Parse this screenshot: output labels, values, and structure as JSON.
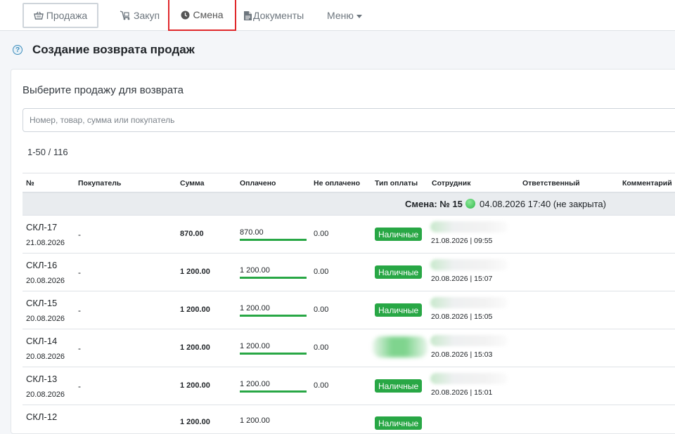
{
  "nav": {
    "sale": "Продажа",
    "purchase": "Закуп",
    "shift": "Смена",
    "documents": "Документы",
    "menu": "Меню"
  },
  "page": {
    "title": "Создание возврата продаж",
    "subtitle": "Выберите продажу для возврата"
  },
  "search": {
    "placeholder": "Номер, товар, сумма или покупатель",
    "value": ""
  },
  "pager": "1-50 / 116",
  "table": {
    "headers": {
      "num": "№",
      "buyer": "Покупатель",
      "sum": "Сумма",
      "paid": "Оплачено",
      "unpaid": "Не оплачено",
      "pay_type": "Тип оплаты",
      "employee": "Сотрудник",
      "responsible": "Ответственный",
      "comment": "Комментарий"
    },
    "shift": {
      "label": "Смена: № 15",
      "info": "04.08.2026 17:40 (не закрыта)"
    },
    "rows": [
      {
        "num": "СКЛ-17",
        "date": "21.08.2026",
        "buyer": "-",
        "sum": "870.00",
        "paid": "870.00",
        "unpaid": "0.00",
        "pay_type": "Наличные",
        "emp_date": "21.08.2026 | 09:55"
      },
      {
        "num": "СКЛ-16",
        "date": "20.08.2026",
        "buyer": "-",
        "sum": "1 200.00",
        "paid": "1 200.00",
        "unpaid": "0.00",
        "pay_type": "Наличные",
        "emp_date": "20.08.2026 | 15:07"
      },
      {
        "num": "СКЛ-15",
        "date": "20.08.2026",
        "buyer": "-",
        "sum": "1 200.00",
        "paid": "1 200.00",
        "unpaid": "0.00",
        "pay_type": "Наличные",
        "emp_date": "20.08.2026 | 15:05"
      },
      {
        "num": "СКЛ-14",
        "date": "20.08.2026",
        "buyer": "-",
        "sum": "1 200.00",
        "paid": "1 200.00",
        "unpaid": "0.00",
        "pay_type": "",
        "emp_date": "20.08.2026 | 15:03"
      },
      {
        "num": "СКЛ-13",
        "date": "20.08.2026",
        "buyer": "-",
        "sum": "1 200.00",
        "paid": "1 200.00",
        "unpaid": "0.00",
        "pay_type": "Наличные",
        "emp_date": "20.08.2026 | 15:01"
      },
      {
        "num": "СКЛ-12",
        "date": "",
        "buyer": "",
        "sum": "1 200.00",
        "paid": "1 200.00",
        "unpaid": "",
        "pay_type": "Наличные",
        "emp_date": ""
      }
    ]
  },
  "colors": {
    "accent_green": "#28a745",
    "highlight_red": "#e0282b"
  }
}
